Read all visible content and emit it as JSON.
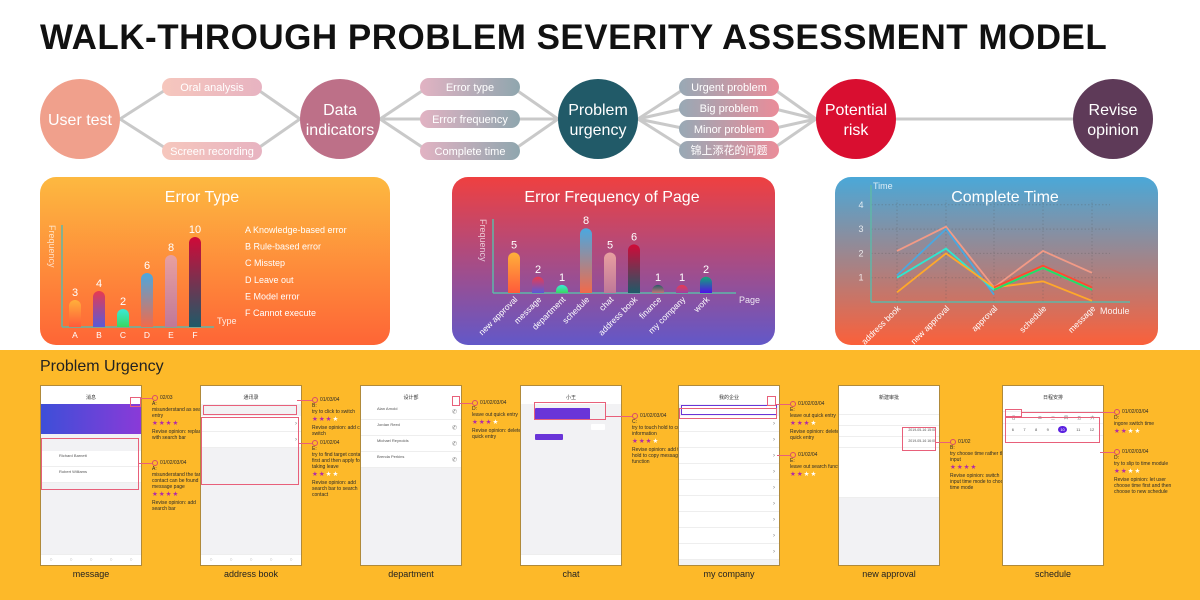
{
  "title": "WALK-THROUGH PROBLEM SEVERITY ASSESSMENT MODEL",
  "flow": {
    "nodes": [
      {
        "lines": [
          "User test"
        ],
        "color": "#f0a08c"
      },
      {
        "lines": [
          "Data",
          "indicators"
        ],
        "color": "#bd7088"
      },
      {
        "lines": [
          "Problem",
          "urgency"
        ],
        "color": "#215a68"
      },
      {
        "lines": [
          "Potential",
          "risk"
        ],
        "color": "#d90e30"
      },
      {
        "lines": [
          "Revise",
          "opinion"
        ],
        "color": "#5e3a58"
      }
    ],
    "group1": [
      "Oral analysis",
      "Screen recording"
    ],
    "group2": [
      "Error type",
      "Error frequency",
      "Complete time"
    ],
    "group3": [
      "Urgent problem",
      "Big problem",
      "Minor problem",
      "锦上添花的问题"
    ]
  },
  "chart_data": [
    {
      "type": "bar",
      "title": "Error Type",
      "xlabel": "Type",
      "ylabel": "Frequency",
      "categories": [
        "A",
        "B",
        "C",
        "D",
        "E",
        "F"
      ],
      "values": [
        3,
        4,
        2,
        6,
        8,
        10
      ],
      "legend": [
        "A  Knowledge-based error",
        "B  Rule-based error",
        "C  Misstep",
        "D  Leave out",
        "E  Model error",
        "F  Cannot execute"
      ],
      "legend_placement": "right"
    },
    {
      "type": "bar",
      "title": "Error Frequency of Page",
      "xlabel": "Page",
      "ylabel": "Frequency",
      "categories": [
        "new approval",
        "message",
        "department",
        "schedule",
        "chat",
        "address book",
        "finance",
        "my company",
        "work"
      ],
      "values": [
        5,
        2,
        1,
        8,
        5,
        6,
        1,
        1,
        2
      ]
    },
    {
      "type": "line",
      "title": "Complete Time",
      "xlabel": "Module",
      "ylabel": "Time",
      "categories": [
        "address book",
        "new approval",
        "approval",
        "schedule",
        "message"
      ],
      "yticks": [
        1,
        2,
        3,
        4
      ],
      "ylim": [
        0,
        4.3
      ],
      "grid": true,
      "series": [
        {
          "color": "#f29a86",
          "values": [
            2.1,
            3.1,
            0.6,
            2.1,
            1.2
          ]
        },
        {
          "color": "#4aa8e0",
          "values": [
            1.1,
            3.0,
            0.3,
            null,
            null
          ]
        },
        {
          "color": "#2de8d0",
          "values": [
            1.0,
            2.2,
            0.5,
            1.4,
            0.5
          ]
        },
        {
          "color": "#ffa82a",
          "values": [
            0.4,
            2.0,
            0.6,
            0.85,
            0.05
          ]
        },
        {
          "color": "#ff4a30",
          "values": [
            null,
            null,
            0.6,
            1.5,
            0.6
          ]
        },
        {
          "color": "#22e060",
          "values": [
            null,
            null,
            0.5,
            1.4,
            0.5
          ]
        }
      ]
    }
  ],
  "urgency": {
    "title": "Problem Urgency",
    "phones": [
      {
        "label": "message",
        "screen": "消息",
        "names": [
          "Richard Barnett",
          "Robert Williams"
        ],
        "annotations": [
          {
            "id": "02/03",
            "type": "A:",
            "text": "misunderstand as search entry",
            "stars": 4,
            "total": 4,
            "revise": "Revise opinion: replaced with search bar"
          },
          {
            "id": "01/02/03/04",
            "type": "A:",
            "text": "misunderstand the target contact can be found in message page",
            "stars": 4,
            "total": 4,
            "revise": "Revise opinion: add search bar"
          }
        ]
      },
      {
        "label": "address book",
        "screen": "通讯录",
        "annotations": [
          {
            "id": "01/03/04",
            "type": "B:",
            "text": "try to click to switch",
            "stars": 3,
            "total": 4,
            "revise": "Revise opinion: add click switch"
          },
          {
            "id": "01/02/04",
            "type": "E:",
            "text": "try to find target contact first and then apply for taking leave",
            "stars": 2,
            "total": 4,
            "revise": "Revise opinion: add search bar to search contact"
          }
        ]
      },
      {
        "label": "department",
        "screen": "设计部",
        "names": [
          "Alan Arnold",
          "Jordan Reed",
          "Michael Reynolds",
          "Brenda Perkins"
        ],
        "annotations": [
          {
            "id": "01/02/03/04",
            "type": "D:",
            "text": "leave out quick entry",
            "stars": 3,
            "total": 4,
            "revise": "Revise opinion: delete this quick entry"
          }
        ]
      },
      {
        "label": "chat",
        "screen": "小王",
        "annotations": [
          {
            "id": "01/02/03/04",
            "type": "C:",
            "text": "try to touch hold to copy information",
            "stars": 3,
            "total": 4,
            "revise": "Revise opinion: add touch hold to copy message function"
          }
        ]
      },
      {
        "label": "my company",
        "screen": "我的企业",
        "annotations": [
          {
            "id": "01/02/03/04",
            "type": "E:",
            "text": "leave out quick entry",
            "stars": 3,
            "total": 4,
            "revise": "Revise opinion: delete this quick entry"
          },
          {
            "id": "01/02/04",
            "type": "E:",
            "text": "leave out search function",
            "stars": 2,
            "total": 4,
            "revise": ""
          }
        ]
      },
      {
        "label": "new approval",
        "screen": "新建审批",
        "times": [
          "2019-05-16 15:00",
          "2019-05-16 16:00"
        ],
        "annotations": [
          {
            "id": "01/02",
            "type": "B:",
            "text": "try choose time rather than input",
            "stars": 4,
            "total": 4,
            "revise": "Revise opinion: switch input time mode to choose time mode"
          }
        ]
      },
      {
        "label": "schedule",
        "screen": "日程安排",
        "weekdays": [
          "日",
          "一",
          "二",
          "三",
          "四",
          "五",
          "六"
        ],
        "days": [
          "6",
          "7",
          "8",
          "9",
          "10",
          "11",
          "12"
        ],
        "annotations": [
          {
            "id": "01/02/03/04",
            "type": "D:",
            "text": "ingore switch time",
            "stars": 2,
            "total": 4,
            "revise": ""
          },
          {
            "id": "01/02/03/04",
            "type": "D:",
            "text": "try to slip to time module",
            "stars": 2,
            "total": 4,
            "revise": "Revise opinion: let user choose time first and then choose to new schedule"
          }
        ]
      }
    ]
  }
}
